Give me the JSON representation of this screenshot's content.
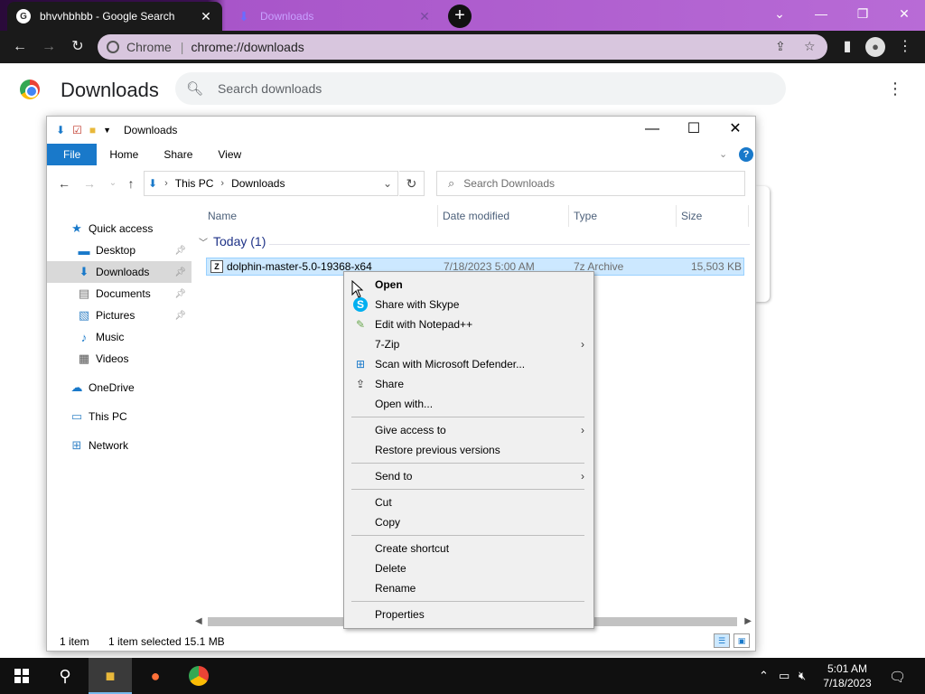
{
  "browser": {
    "tabs": [
      {
        "title": "bhvvhbhbb - Google Search",
        "close": "✕"
      },
      {
        "title": "Downloads",
        "close": "✕"
      }
    ],
    "new_tab": "+",
    "window_controls": {
      "dropdown": "⌄",
      "minimize": "—",
      "restore": "❐",
      "close": "✕"
    },
    "toolbar": {
      "back": "←",
      "forward": "→",
      "reload": "↻",
      "site_label": "Chrome",
      "url": "chrome://downloads",
      "share": "⇪",
      "star": "☆",
      "sidepanel": "▮",
      "menu": "⋮",
      "profile": "●"
    }
  },
  "downloads_page": {
    "title": "Downloads",
    "search_placeholder": "Search downloads",
    "menu": "⋮"
  },
  "explorer": {
    "title": "Downloads",
    "window_controls": {
      "minimize": "—",
      "maximize": "☐",
      "close": "✕"
    },
    "ribbon_tabs": [
      "File",
      "Home",
      "Share",
      "View"
    ],
    "help": "?",
    "address": {
      "root": "This PC",
      "folder": "Downloads"
    },
    "search_placeholder": "Search Downloads",
    "nav": {
      "quick_access": "Quick access",
      "desktop": "Desktop",
      "downloads": "Downloads",
      "documents": "Documents",
      "pictures": "Pictures",
      "music": "Music",
      "videos": "Videos",
      "onedrive": "OneDrive",
      "this_pc": "This PC",
      "network": "Network"
    },
    "columns": [
      "Name",
      "Date modified",
      "Type",
      "Size"
    ],
    "group": "Today (1)",
    "file": {
      "name": "dolphin-master-5.0-19368-x64",
      "date": "7/18/2023 5:00 AM",
      "type": "7z Archive",
      "size": "15,503 KB"
    },
    "status": {
      "count": "1 item",
      "selected": "1 item selected",
      "size": "15.1 MB"
    }
  },
  "context_menu": {
    "open": "Open",
    "share_skype": "Share with Skype",
    "edit_notepad": "Edit with Notepad++",
    "seven_zip": "7-Zip",
    "defender": "Scan with Microsoft Defender...",
    "share": "Share",
    "open_with": "Open with...",
    "give_access": "Give access to",
    "restore": "Restore previous versions",
    "send_to": "Send to",
    "cut": "Cut",
    "copy": "Copy",
    "create_shortcut": "Create shortcut",
    "delete": "Delete",
    "rename": "Rename",
    "properties": "Properties"
  },
  "taskbar": {
    "time": "5:01 AM",
    "date": "7/18/2023"
  },
  "colors": {
    "accent": "#1979ca",
    "selection": "#cce8ff",
    "tab_gradient": "#b86bd6"
  }
}
